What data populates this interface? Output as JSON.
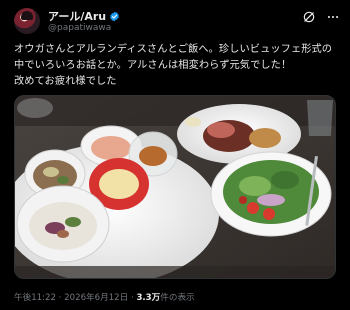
{
  "post": {
    "display_name": "アール/Aru",
    "handle": "@papatiwawa",
    "text": "オウガさんとアルランディスさんとご飯へ。珍しいビュッフェ形式の中でいろいろお話とか。アルさんは相変わらず元気でした！\n改めてお疲れ様でした",
    "time": "午後11:22",
    "date": "2026年6月12日",
    "separator": "·",
    "views_count": "3.3万",
    "views_label": "件の表示"
  },
  "icons": {
    "avatar": "avatar",
    "verified": "verified-badge-icon",
    "grok": "grok-icon",
    "more": "more-options-icon",
    "verified_color": "#1d9bf0"
  },
  "media": {
    "description_icon": "buffet-dinner-photo"
  }
}
